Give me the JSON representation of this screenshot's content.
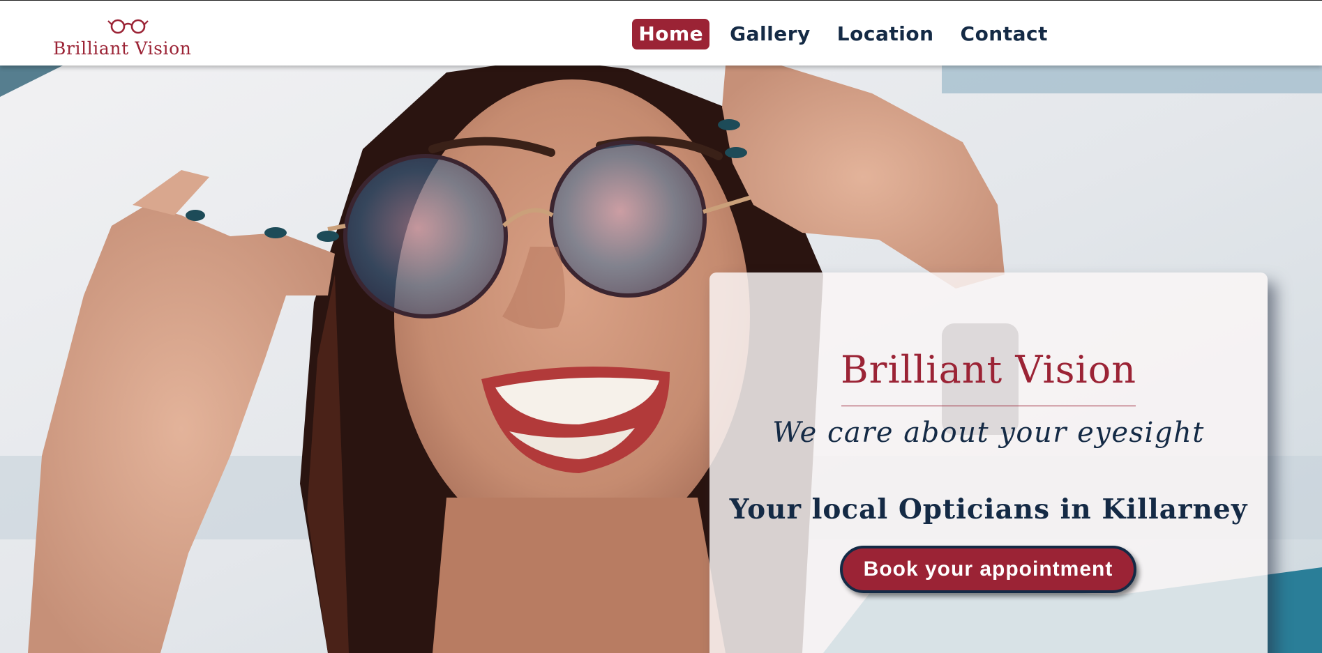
{
  "brand": {
    "logo_text": "Brilliant Vision",
    "logo_icon": "glasses-icon",
    "accent_color": "#9b2335",
    "navy_color": "#142a45"
  },
  "nav": {
    "items": [
      {
        "label": "Home",
        "active": true
      },
      {
        "label": "Gallery",
        "active": false
      },
      {
        "label": "Location",
        "active": false
      },
      {
        "label": "Contact",
        "active": false
      }
    ]
  },
  "hero": {
    "image": "woman-adjusting-glasses-photo",
    "card": {
      "title": "Brilliant Vision",
      "tagline": "We care about your eyesight",
      "heading": "Your local Opticians in Killarney",
      "button_label": "Book your appointment"
    }
  }
}
